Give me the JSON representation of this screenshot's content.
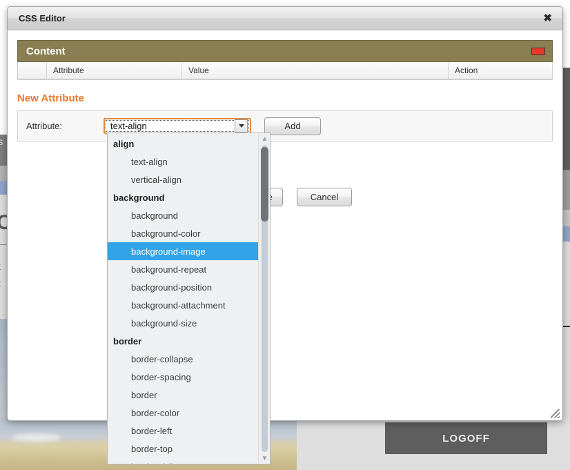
{
  "background": {
    "logoff_label": "LOGOFF",
    "left_fragments": {
      "dark_text": "S",
      "heading_letter": "C",
      "line1": "t",
      "line2": "t"
    }
  },
  "modal": {
    "title": "CSS Editor",
    "close_icon": "✖",
    "content_panel": {
      "title": "Content",
      "minimize_icon": "minimize-box",
      "minimize_color": "#e8382b",
      "bar_color": "#8a7f52",
      "columns": [
        "",
        "Attribute",
        "Value",
        "Action"
      ],
      "rows": []
    },
    "new_attribute": {
      "heading": "New Attribute",
      "heading_color": "#e8772e",
      "field_label": "Attribute:",
      "select_value": "text-align",
      "dropdown_arrow_icon": "chevron-down-icon",
      "add_label": "Add"
    },
    "actions": {
      "save_label": "Save",
      "cancel_label": "Cancel"
    },
    "resize_handle_icon": "resize-grip-icon"
  },
  "dropdown": {
    "selected": "background-image",
    "highlight_color": "#32a3e8",
    "scroll_up_icon": "chevron-up-icon",
    "scroll_down_icon": "chevron-down-icon",
    "items": [
      {
        "label": "align",
        "type": "group"
      },
      {
        "label": "text-align",
        "type": "option"
      },
      {
        "label": "vertical-align",
        "type": "option"
      },
      {
        "label": "background",
        "type": "group"
      },
      {
        "label": "background",
        "type": "option"
      },
      {
        "label": "background-color",
        "type": "option"
      },
      {
        "label": "background-image",
        "type": "option",
        "selected": true
      },
      {
        "label": "background-repeat",
        "type": "option"
      },
      {
        "label": "background-position",
        "type": "option"
      },
      {
        "label": "background-attachment",
        "type": "option"
      },
      {
        "label": "background-size",
        "type": "option"
      },
      {
        "label": "border",
        "type": "group"
      },
      {
        "label": "border-collapse",
        "type": "option"
      },
      {
        "label": "border-spacing",
        "type": "option"
      },
      {
        "label": "border",
        "type": "option"
      },
      {
        "label": "border-color",
        "type": "option"
      },
      {
        "label": "border-left",
        "type": "option"
      },
      {
        "label": "border-top",
        "type": "option"
      },
      {
        "label": "border-right",
        "type": "option"
      }
    ]
  }
}
